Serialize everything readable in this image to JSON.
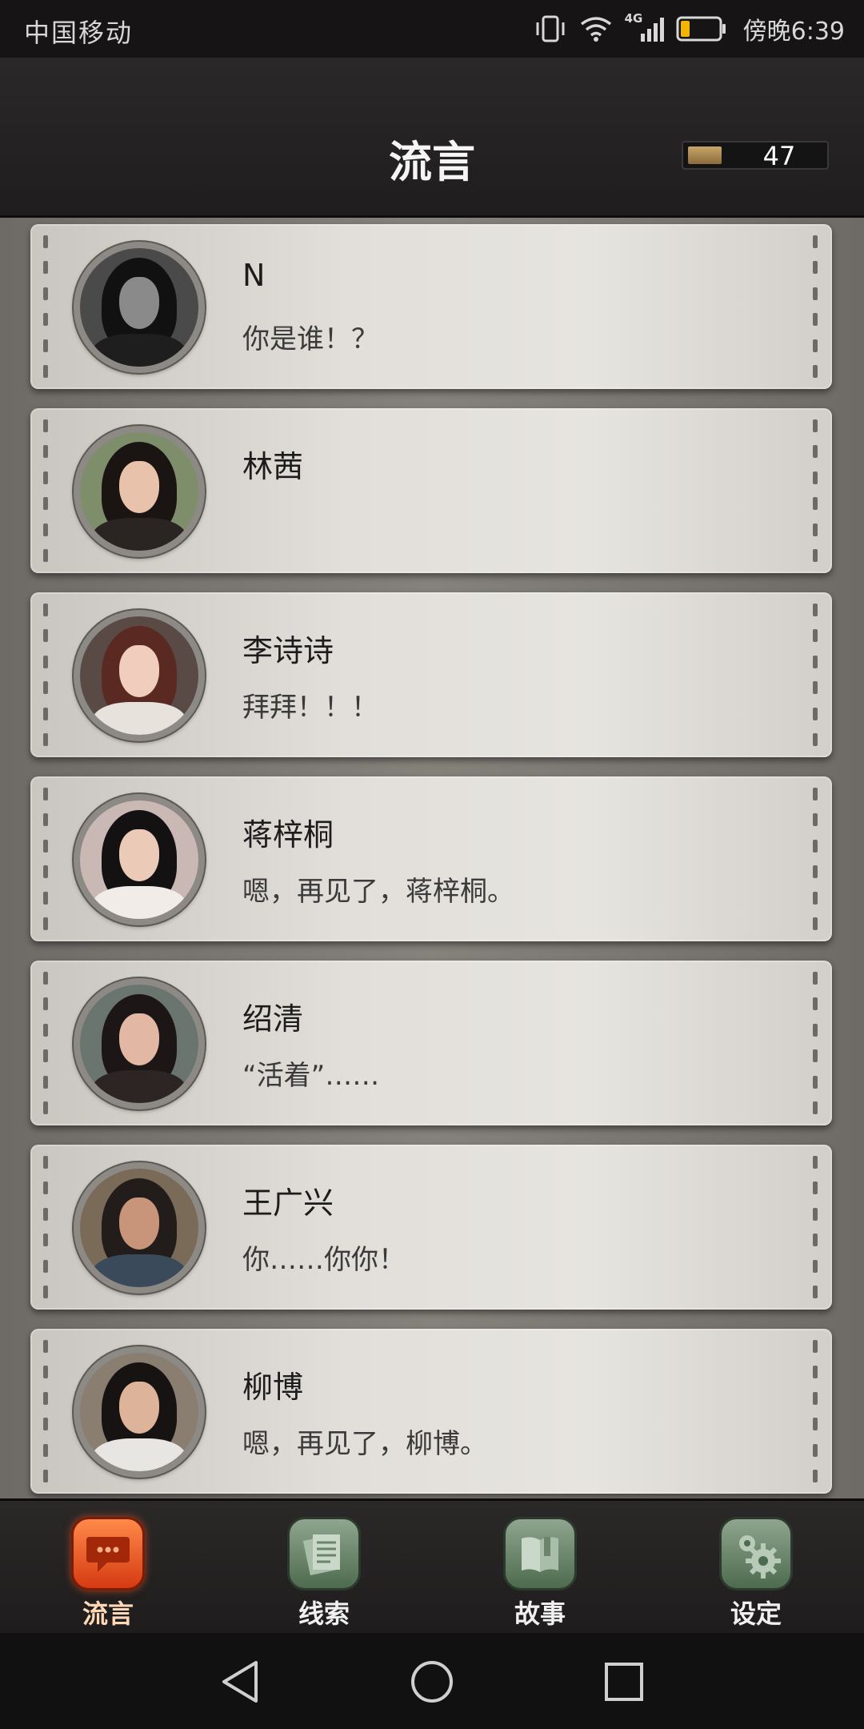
{
  "status_bar": {
    "carrier": "中国移动",
    "network": "4G",
    "time": "傍晚6:39",
    "icons": [
      "vibrate-icon",
      "wifi-icon",
      "signal-icon",
      "battery-icon"
    ]
  },
  "header": {
    "title": "流言",
    "currency_value": "47",
    "currency_icon": "gold-bar-icon"
  },
  "contacts": [
    {
      "name": "N",
      "last_message": "你是谁！？",
      "avatar_colors": {
        "bg": "#4a4a4a",
        "hair": "#111111",
        "face": "#8a8a8a",
        "body": "#1e1e1e"
      }
    },
    {
      "name": "林茜",
      "last_message": "",
      "avatar_colors": {
        "bg": "#7e8d6a",
        "hair": "#1a1412",
        "face": "#e8c2ab",
        "body": "#2a2422"
      }
    },
    {
      "name": "李诗诗",
      "last_message": "拜拜！！！",
      "avatar_colors": {
        "bg": "#5a4a46",
        "hair": "#5a2a22",
        "face": "#f0cdbd",
        "body": "#e8e2dc"
      }
    },
    {
      "name": "蒋梓桐",
      "last_message": "嗯，再见了，蒋梓桐。",
      "avatar_colors": {
        "bg": "#c9b8b4",
        "hair": "#141112",
        "face": "#eccab8",
        "body": "#f2ece8"
      }
    },
    {
      "name": "绍清",
      "last_message": "“活着”……",
      "avatar_colors": {
        "bg": "#6a7570",
        "hair": "#1c1716",
        "face": "#e2b8a4",
        "body": "#2c2524"
      }
    },
    {
      "name": "王广兴",
      "last_message": "你……你你！",
      "avatar_colors": {
        "bg": "#7a6a58",
        "hair": "#221d1a",
        "face": "#c8957a",
        "body": "#3a4a5a"
      }
    },
    {
      "name": "柳博",
      "last_message": "嗯，再见了，柳博。",
      "avatar_colors": {
        "bg": "#8a7e70",
        "hair": "#161312",
        "face": "#ddb39a",
        "body": "#e8e6e2"
      }
    }
  ],
  "tabs": [
    {
      "label": "流言",
      "icon": "chat-bubble-icon",
      "active": true
    },
    {
      "label": "线索",
      "icon": "clue-papers-icon",
      "active": false
    },
    {
      "label": "故事",
      "icon": "story-book-icon",
      "active": false
    },
    {
      "label": "设定",
      "icon": "gear-icon",
      "active": false
    }
  ],
  "nav_bar": {
    "buttons": [
      "back-icon",
      "home-icon",
      "recents-icon"
    ]
  }
}
